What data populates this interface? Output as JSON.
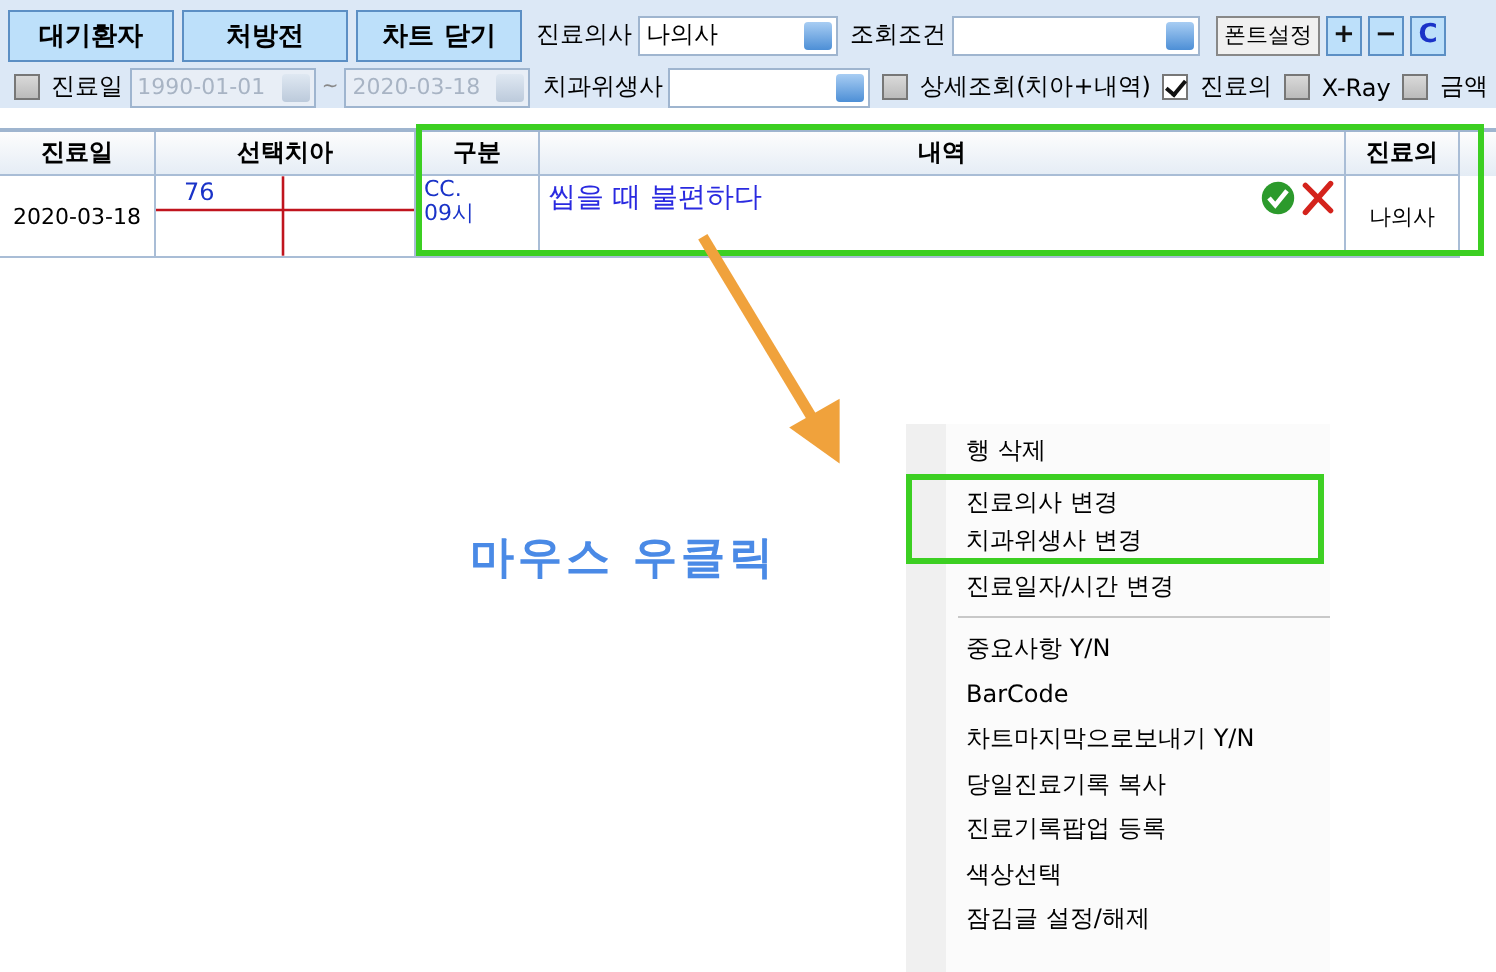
{
  "toolbar": {
    "buttons": [
      "대기환자",
      "처방전",
      "차트 닫기"
    ],
    "doctor": {
      "label": "진료의사",
      "value": "나의사"
    },
    "query": {
      "label": "조회조건"
    },
    "font_button": "폰트설정",
    "size_buttons": [
      "+",
      "−",
      "C"
    ],
    "date_filter": {
      "label": "진료일",
      "checked": false,
      "from": "1990-01-01",
      "separator": "~",
      "to": "2020-03-18"
    },
    "hygienist": {
      "label": "치과위생사"
    },
    "checkboxes": [
      {
        "label": "상세조회(치아+내역)",
        "checked": false
      },
      {
        "label": "진료의",
        "checked": true
      },
      {
        "label": "X-Ray",
        "checked": false
      },
      {
        "label": "금액",
        "checked": false
      }
    ]
  },
  "table": {
    "columns": [
      "진료일",
      "선택치아",
      "구분",
      "내역",
      "진료의"
    ],
    "highlighted": true,
    "rows": [
      {
        "date": "2020-03-18",
        "tooth": "76",
        "type": [
          "CC.",
          "09시"
        ],
        "detail": "씹을 때 불편하다",
        "doctor": "나의사"
      }
    ]
  },
  "annotation": "마우스 우클릭",
  "context_menu": {
    "groups": [
      [
        {
          "label": "행 삭제",
          "highlighted": false
        },
        {
          "label": "진료의사 변경",
          "highlighted": true
        },
        {
          "label": "치과위생사 변경",
          "highlighted": true
        },
        {
          "label": "진료일자/시간 변경",
          "highlighted": false
        }
      ],
      [
        {
          "label": "중요사항 Y/N",
          "highlighted": false
        },
        {
          "label": "BarCode",
          "highlighted": false
        },
        {
          "label": "차트마지막으로보내기 Y/N",
          "highlighted": false
        },
        {
          "label": "당일진료기록 복사",
          "highlighted": false
        },
        {
          "label": "진료기록팝업 등록",
          "highlighted": false
        },
        {
          "label": "색상선택",
          "highlighted": false
        },
        {
          "label": "잠김글 설정/해제",
          "highlighted": false
        }
      ]
    ]
  }
}
